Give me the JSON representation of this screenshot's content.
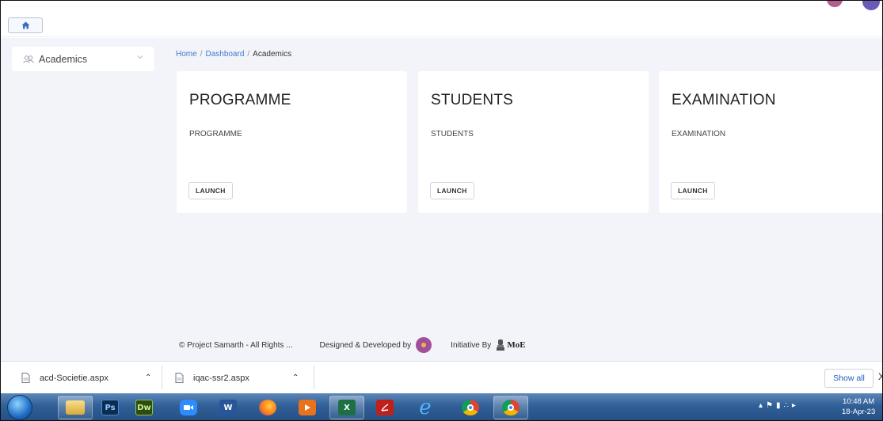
{
  "sidebar": {
    "items": [
      {
        "label": "Academics"
      }
    ]
  },
  "breadcrumb": {
    "home": "Home",
    "dashboard": "Dashboard",
    "current": "Academics",
    "separator": "/"
  },
  "cards": [
    {
      "title": "PROGRAMME",
      "description": "PROGRAMME",
      "button": "LAUNCH"
    },
    {
      "title": "STUDENTS",
      "description": "STUDENTS",
      "button": "LAUNCH"
    },
    {
      "title": "EXAMINATION",
      "description": "EXAMINATION",
      "button": "LAUNCH"
    }
  ],
  "footer": {
    "copyright": "© Project Samarth - All Rights ...",
    "designed_by": "Designed & Developed by",
    "initiative_by": "Initiative By",
    "moe": "MoE"
  },
  "downloads": {
    "items": [
      {
        "filename": "acd-Societie.aspx"
      },
      {
        "filename": "iqac-ssr2.aspx"
      }
    ],
    "show_all": "Show all",
    "close": "X"
  },
  "taskbar": {
    "apps": [
      "start-orb",
      "file-explorer",
      "photoshop",
      "dreamweaver",
      "zoom",
      "word",
      "firefox",
      "media-player",
      "excel",
      "acrobat",
      "internet-explorer",
      "chrome",
      "chrome-profile"
    ],
    "ps_label": "Ps",
    "dw_label": "Dw",
    "clock_time": "10:48 AM",
    "clock_date": "18-Apr-23"
  },
  "colors": {
    "main_bg": "#f2f4f9",
    "link": "#3f7bd0",
    "taskbar": "#2f5f96"
  }
}
